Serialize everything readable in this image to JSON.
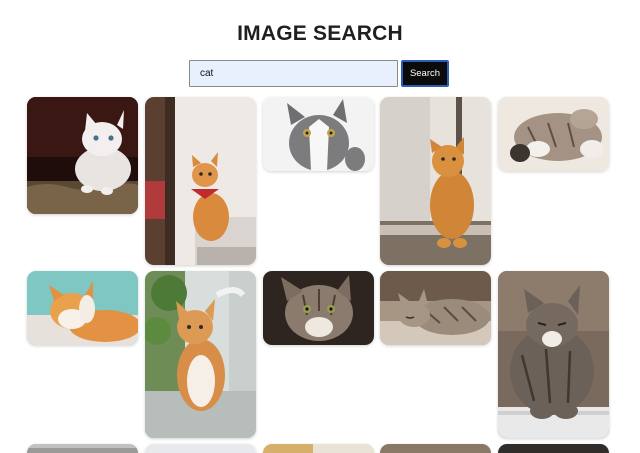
{
  "header": {
    "title": "IMAGE SEARCH"
  },
  "search": {
    "query": "cat",
    "button_label": "Search"
  },
  "results": [
    {
      "subject": "white-kitten-on-basket"
    },
    {
      "subject": "orange-cat-with-red-bandana"
    },
    {
      "subject": "grey-white-cat-portrait"
    },
    {
      "subject": "orange-cat-by-window"
    },
    {
      "subject": "tabby-cat-lying-paws-up"
    },
    {
      "subject": "orange-cat-licking-paw"
    },
    {
      "subject": "orange-white-cat-near-door"
    },
    {
      "subject": "tabby-cat-closeup"
    },
    {
      "subject": "sleeping-tabby-cat"
    },
    {
      "subject": "grumpy-tabby-cat-sitting"
    }
  ]
}
